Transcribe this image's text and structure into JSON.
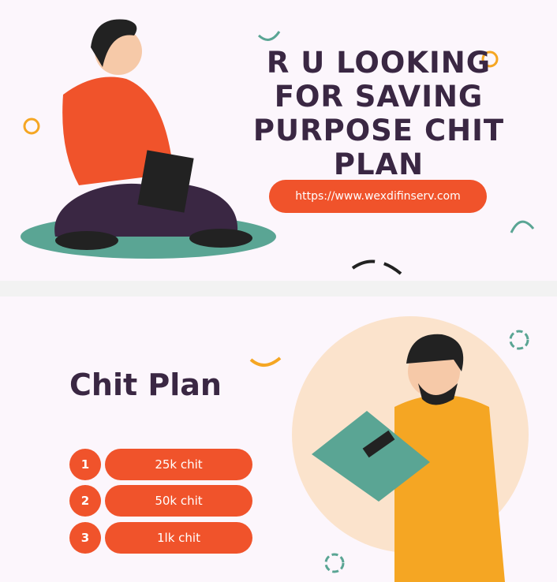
{
  "top": {
    "headline_lines": [
      "R U LOOKING",
      "FOR SAVING",
      "PURPOSE CHIT",
      "PLAN"
    ],
    "url": "https://www.wexdifinserv.com"
  },
  "bottom": {
    "title": "Chit Plan",
    "plans": [
      {
        "number": "1",
        "label": "25k chit"
      },
      {
        "number": "2",
        "label": "50k chit"
      },
      {
        "number": "3",
        "label": "1lk chit"
      }
    ]
  },
  "colors": {
    "accent": "#f0532b",
    "text": "#3a2743",
    "circle": "#fbe3cc",
    "teal": "#5aa594",
    "yellow": "#f5a623"
  }
}
